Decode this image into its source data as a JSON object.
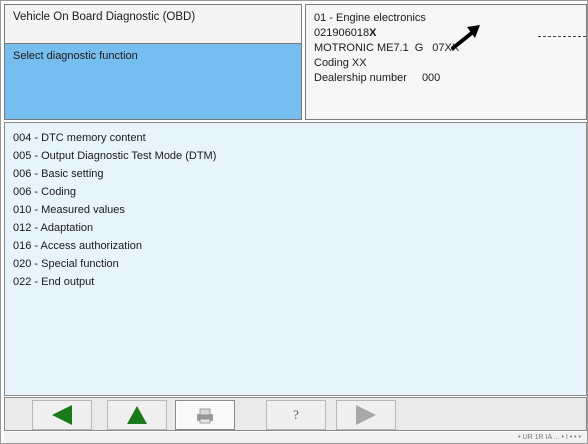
{
  "header": {
    "title": "Vehicle On Board Diagnostic (OBD)",
    "function_label": "Select diagnostic function"
  },
  "ecu_info": {
    "system": "01 - Engine electronics",
    "part_number_prefix": "021906018",
    "part_number_suffix": "X",
    "component_name": "MOTRONIC ME7.1",
    "component_g": "G",
    "component_code": "07XX",
    "coding": "Coding XX",
    "dealership_label": "Dealership number",
    "dealership_value": "000"
  },
  "functions": [
    "004 - DTC memory content",
    "005 - Output Diagnostic Test Mode (DTM)",
    "006 - Basic setting",
    "006 - Coding",
    "010 - Measured values",
    "012 - Adaptation",
    "016 - Access authorization",
    "020 - Special function",
    "022 - End output"
  ],
  "toolbar": {
    "help_label": "?",
    "icons": [
      "back-arrow-icon",
      "up-arrow-icon",
      "print-icon",
      "help-icon",
      "forward-arrow-icon"
    ],
    "colors": {
      "active_arrow": "#1a7a1a",
      "disabled_arrow": "#a8a8a8"
    }
  },
  "statusbar": {
    "text": "• UR 1R IA ... • I • • •"
  },
  "colors": {
    "function_band": "#76bdf0",
    "list_bg": "#e7f4fb"
  }
}
